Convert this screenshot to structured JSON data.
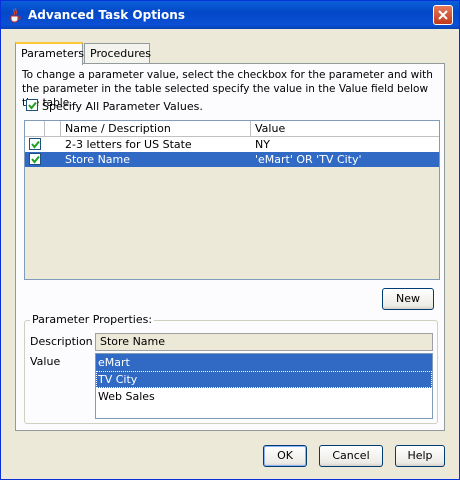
{
  "window": {
    "title": "Advanced Task Options",
    "icon": "java-cup-icon"
  },
  "tabs": [
    {
      "label": "Parameters",
      "active": true
    },
    {
      "label": "Procedures",
      "active": false
    }
  ],
  "instructions": "To change a parameter value, select the checkbox for the parameter and with the parameter in the table selected specify the value in the Value field below the table.",
  "specify_all": {
    "label": "Specify All Parameter Values.",
    "checked": true
  },
  "table": {
    "columns": [
      "",
      "Name / Description",
      "Value"
    ],
    "rows": [
      {
        "checked": true,
        "name": "2-3 letters for US State",
        "value": "NY",
        "selected": false
      },
      {
        "checked": true,
        "name": "Store Name",
        "value": "'eMart' OR 'TV City'",
        "selected": true
      }
    ]
  },
  "new_button": "New",
  "properties": {
    "group_title": "Parameter Properties:",
    "description_label": "Description",
    "description_value": "Store Name",
    "value_label": "Value",
    "value_options": [
      {
        "label": "eMart",
        "selected": true
      },
      {
        "label": "TV City",
        "selected": true
      },
      {
        "label": "Web Sales",
        "selected": false
      }
    ]
  },
  "buttons": {
    "ok": "OK",
    "cancel": "Cancel",
    "help": "Help"
  },
  "colors": {
    "titlebar": "#0a5fd8",
    "selection": "#316ac5",
    "dialog_bg": "#ece9d8",
    "tab_highlight": "#ffc83c"
  }
}
